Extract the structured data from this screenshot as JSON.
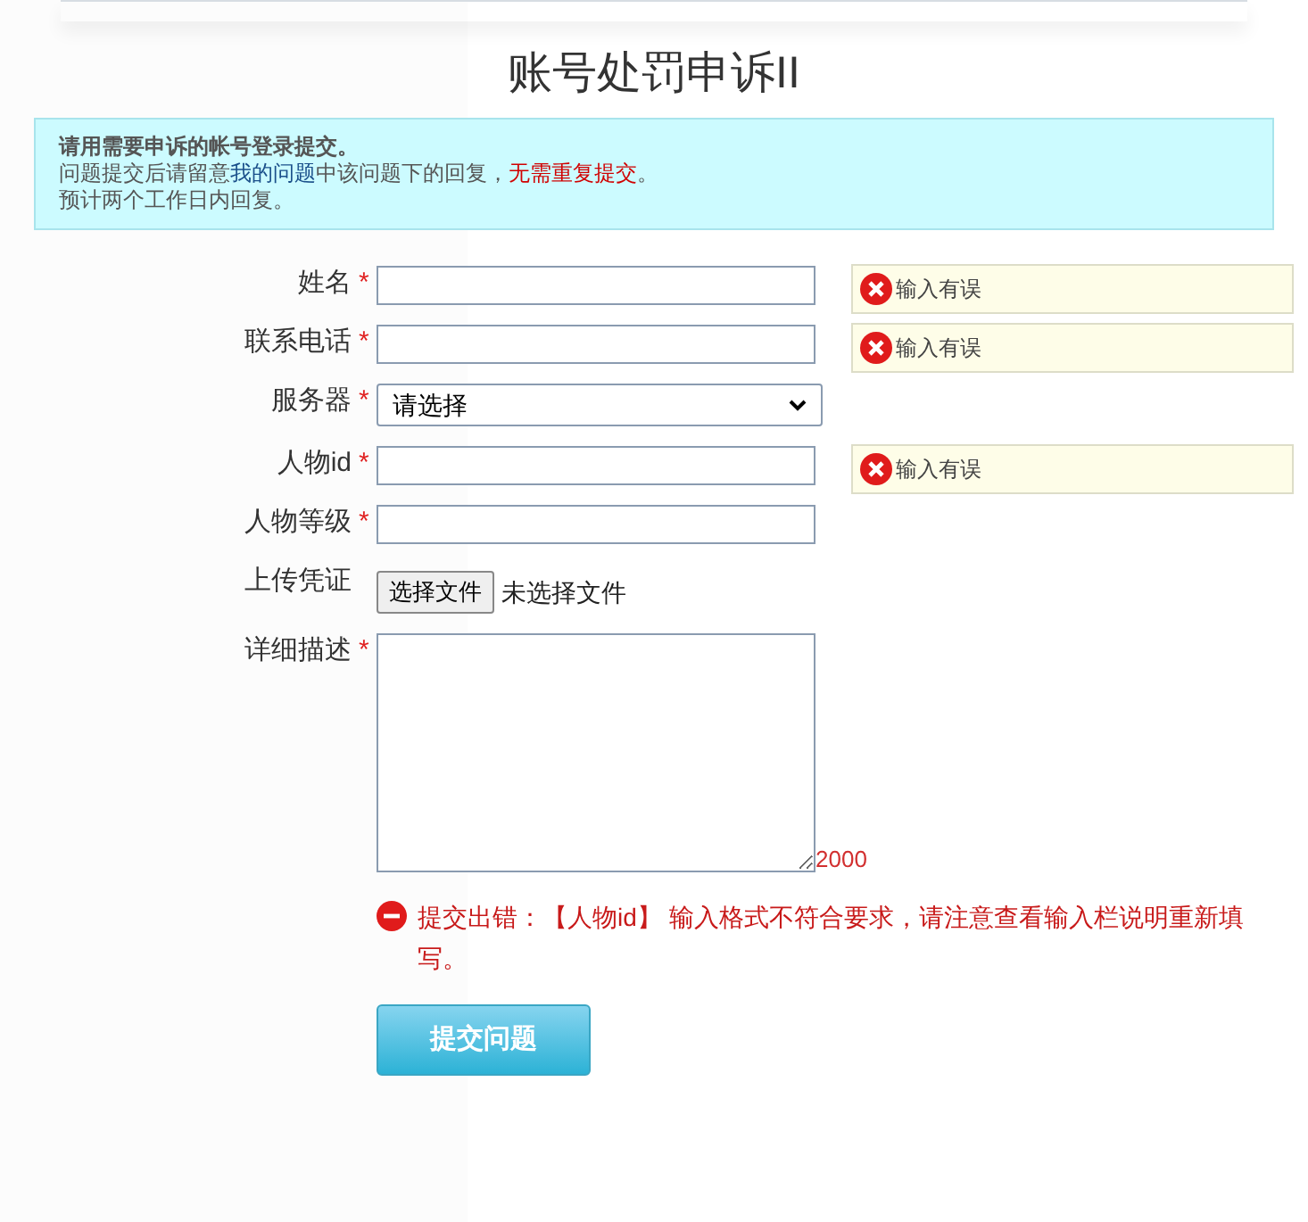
{
  "page_title": "账号处罚申诉II",
  "notice": {
    "lines": [
      [
        {
          "kind": "bold",
          "text": "请用需要申诉的帐号登录提交。"
        }
      ],
      [
        {
          "kind": "plain",
          "text": "问题提交后请留意"
        },
        {
          "kind": "link",
          "text": "我的问题"
        },
        {
          "kind": "plain",
          "text": "中该问题下的回复，"
        },
        {
          "kind": "warn",
          "text": "无需重复提交"
        },
        {
          "kind": "plain",
          "text": "。"
        }
      ],
      [
        {
          "kind": "plain",
          "text": "预计两个工作日内回复。"
        }
      ]
    ]
  },
  "fields": [
    {
      "kind": "text",
      "label": "姓名",
      "required_mark": "*",
      "error": "输入有误"
    },
    {
      "kind": "text",
      "label": "联系电话",
      "required_mark": "*",
      "error": "输入有误"
    },
    {
      "kind": "select",
      "label": "服务器",
      "required_mark": "*",
      "value": "请选择"
    },
    {
      "kind": "text",
      "label": "人物id",
      "required_mark": "*",
      "error": "输入有误"
    },
    {
      "kind": "text",
      "label": "人物等级",
      "required_mark": "*"
    },
    {
      "kind": "file",
      "label": "上传凭证",
      "button": "选择文件",
      "status": "未选择文件"
    },
    {
      "kind": "textarea",
      "label": "详细描述",
      "required_mark": "*",
      "counter": "2000"
    }
  ],
  "submit_error": "提交出错：【人物id】 输入格式不符合要求，请注意查看输入栏说明重新填写。",
  "submit_button": "提交问题"
}
